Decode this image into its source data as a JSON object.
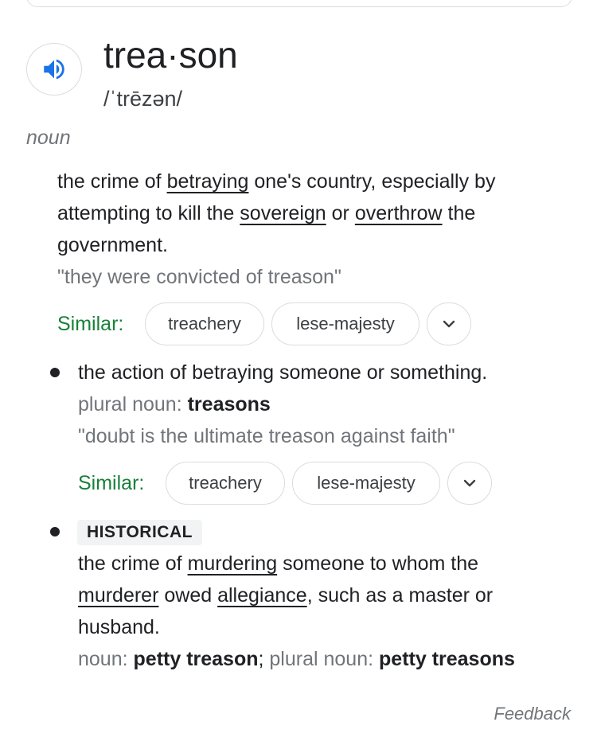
{
  "headword": "trea·son",
  "phonetic": "/ˈtrēzən/",
  "audio_icon": "speaker-icon",
  "part_of_speech": "noun",
  "sense1": {
    "def_l1_a": "the crime of ",
    "def_l1_link": "betraying",
    "def_l1_b": " one's country, especially by",
    "def_l2_a": "attempting to kill the ",
    "def_l2_link1": "sovereign",
    "def_l2_mid": " or ",
    "def_l2_link2": "overthrow",
    "def_l2_b": " the",
    "def_l3": "government.",
    "example": "\"they were convicted of treason\"",
    "similar_label": "Similar:",
    "similar": [
      "treachery",
      "lese-majesty"
    ]
  },
  "sense2": {
    "definition": "the action of betraying someone or something.",
    "plural_label": "plural noun:",
    "plural_value": "treasons",
    "example": "\"doubt is the ultimate treason against faith\"",
    "similar_label": "Similar:",
    "similar": [
      "treachery",
      "lese-majesty"
    ]
  },
  "sense3": {
    "tag": "HISTORICAL",
    "def_l1_a": "the crime of ",
    "def_l1_link": "murdering",
    "def_l1_b": " someone to whom the",
    "def_l2_link1": "murderer",
    "def_l2_mid": " owed ",
    "def_l2_link2": "allegiance",
    "def_l2_b": ", such as a master or",
    "def_l3": "husband.",
    "form_label": "noun:",
    "form_value": "petty treason",
    "form_sep": ";",
    "plural_label": "plural noun:",
    "plural_value": "petty treasons"
  },
  "feedback": "Feedback",
  "colors": {
    "accent_blue": "#1a73e8",
    "similar_green": "#188038",
    "gray_text": "#70757a"
  }
}
